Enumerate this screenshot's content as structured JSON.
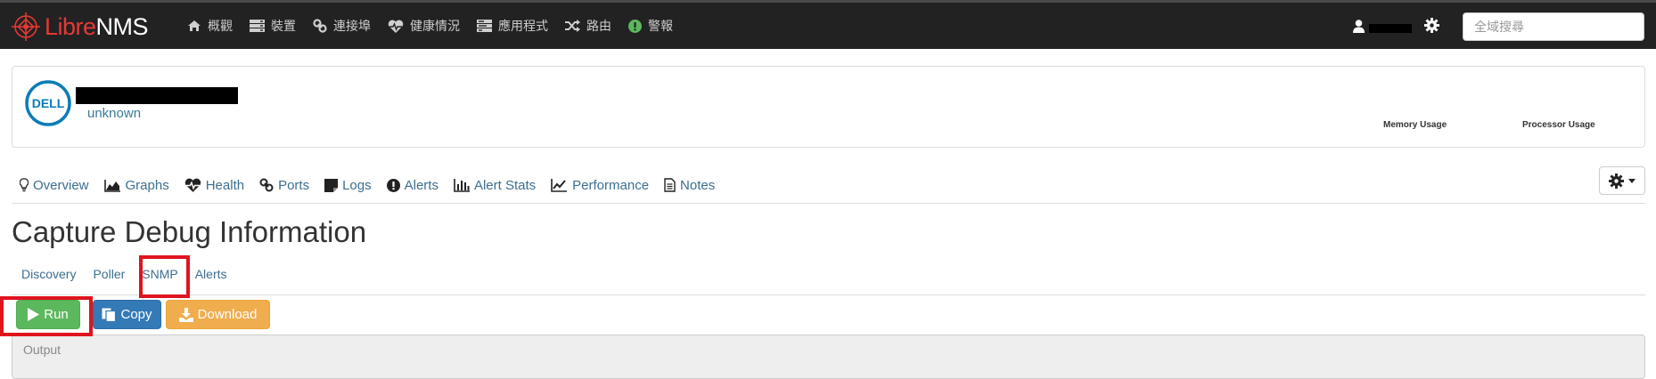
{
  "brand": {
    "name_part1": "Libre",
    "name_part2": "NMS"
  },
  "nav": {
    "items": [
      {
        "label": "概觀",
        "icon": "home-icon"
      },
      {
        "label": "裝置",
        "icon": "server-icon"
      },
      {
        "label": "連接埠",
        "icon": "link-icon"
      },
      {
        "label": "健康情況",
        "icon": "heartbeat-icon"
      },
      {
        "label": "應用程式",
        "icon": "tasks-icon"
      },
      {
        "label": "路由",
        "icon": "random-icon"
      },
      {
        "label": "警報",
        "icon": "exclamation-circle-icon"
      }
    ],
    "search": {
      "placeholder": "全域搜尋"
    }
  },
  "device": {
    "os": "unknown",
    "metrics": [
      "Memory Usage",
      "Processor Usage"
    ]
  },
  "device_tabs": [
    {
      "label": "Overview",
      "icon": "lightbulb-icon"
    },
    {
      "label": "Graphs",
      "icon": "area-chart-icon"
    },
    {
      "label": "Health",
      "icon": "heartbeat-icon"
    },
    {
      "label": "Ports",
      "icon": "link-icon"
    },
    {
      "label": "Logs",
      "icon": "sticky-note-icon"
    },
    {
      "label": "Alerts",
      "icon": "exclamation-circle-icon"
    },
    {
      "label": "Alert Stats",
      "icon": "bar-chart-icon"
    },
    {
      "label": "Performance",
      "icon": "line-chart-icon"
    },
    {
      "label": "Notes",
      "icon": "file-text-icon"
    }
  ],
  "page": {
    "title": "Capture Debug Information"
  },
  "sub_tabs": [
    {
      "label": "Discovery"
    },
    {
      "label": "Poller"
    },
    {
      "label": "SNMP"
    },
    {
      "label": "Alerts"
    }
  ],
  "actions": {
    "run": "Run",
    "copy": "Copy",
    "download": "Download"
  },
  "output": {
    "placeholder": "Output"
  },
  "colors": {
    "navbar": "#222222",
    "brand_red": "#e53935",
    "run": "#5cb85c",
    "copy": "#337ab7",
    "download": "#f0ad4e",
    "highlight": "#e0141e",
    "link": "#3c6e8f"
  }
}
